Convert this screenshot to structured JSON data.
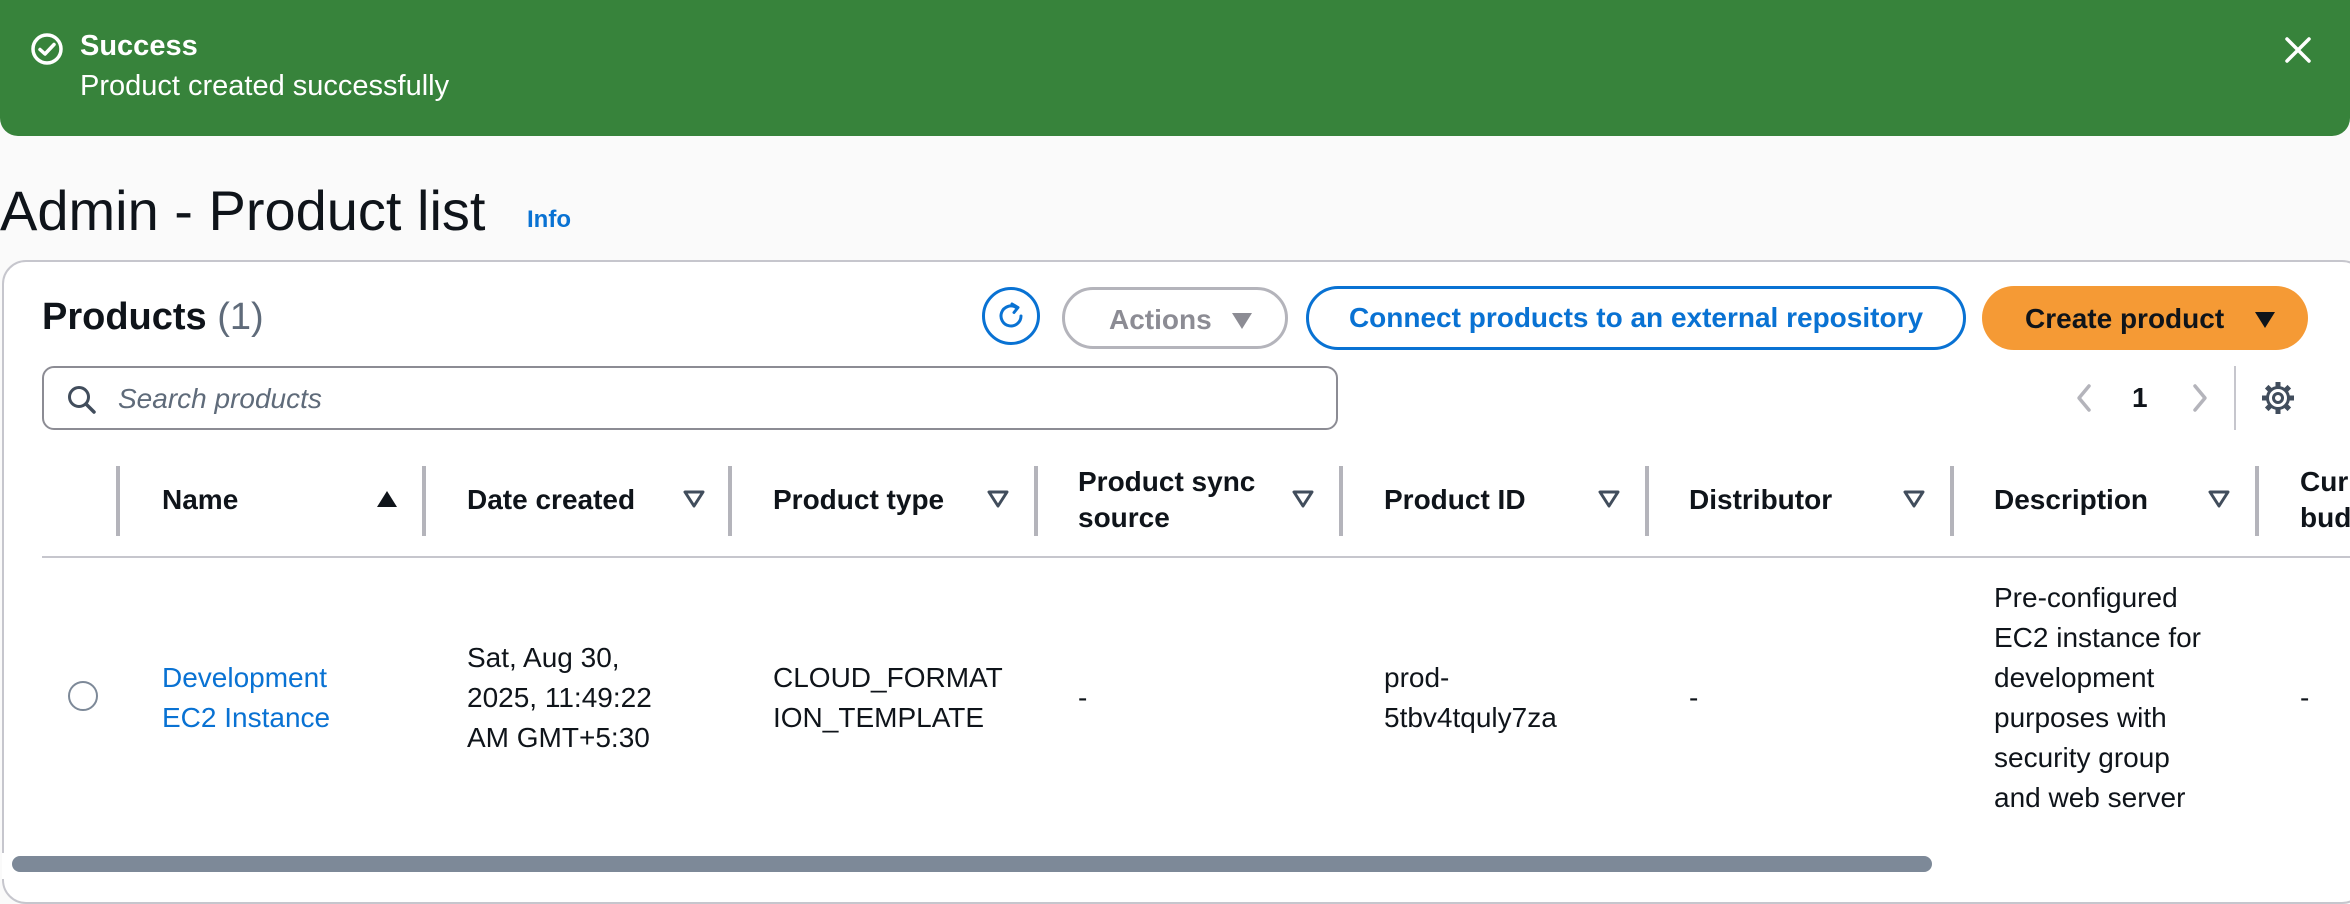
{
  "flash": {
    "title": "Success",
    "message": "Product created successfully",
    "icon": "check-circle-icon",
    "close_icon": "close-icon",
    "color": "#37833b"
  },
  "header": {
    "title": "Admin - Product list",
    "info": "Info"
  },
  "panel": {
    "heading": "Products",
    "count": "(1)",
    "refresh_icon": "refresh-icon",
    "actions_label": "Actions",
    "connect_label": "Connect products to an external repository",
    "create_label": "Create product",
    "accent": "#0972d3",
    "create_color": "#f59a35"
  },
  "search": {
    "placeholder": "Search products",
    "value": ""
  },
  "pagination": {
    "current": "1",
    "prev_icon": "chevron-left-icon",
    "next_icon": "chevron-right-icon",
    "settings_icon": "gear-icon"
  },
  "table": {
    "columns": [
      {
        "label": "Name",
        "sort": "ascending"
      },
      {
        "label": "Date created",
        "sort": "none"
      },
      {
        "label": "Product type",
        "sort": "none"
      },
      {
        "label": "Product sync source",
        "sort": "none"
      },
      {
        "label": "Product ID",
        "sort": "none"
      },
      {
        "label": "Distributor",
        "sort": "none"
      },
      {
        "label": "Description",
        "sort": "none"
      },
      {
        "label": "Curr... bud...",
        "sort": "none"
      }
    ],
    "rows": [
      {
        "name": "Development EC2 Instance",
        "date_created": "Sat, Aug 30, 2025, 11:49:22 AM GMT+5:30",
        "product_type": "CLOUD_FORMATION_TEMPLATE",
        "sync_source": "-",
        "product_id": "prod-5tbv4tquly7za",
        "distributor": "-",
        "description": "Pre-configured EC2 instance for development purposes with security group and web server",
        "budget": "-"
      }
    ]
  }
}
